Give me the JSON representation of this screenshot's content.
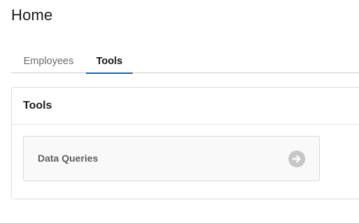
{
  "page": {
    "title": "Home"
  },
  "tabs": [
    {
      "label": "Employees",
      "active": false
    },
    {
      "label": "Tools",
      "active": true
    }
  ],
  "colors": {
    "accent": "#1b5fc1",
    "arrow_circle": "#c6c6c6"
  },
  "tools_panel": {
    "title": "Tools",
    "items": [
      {
        "label": "Data Queries",
        "icon": "arrow-right-circle-icon"
      }
    ]
  }
}
